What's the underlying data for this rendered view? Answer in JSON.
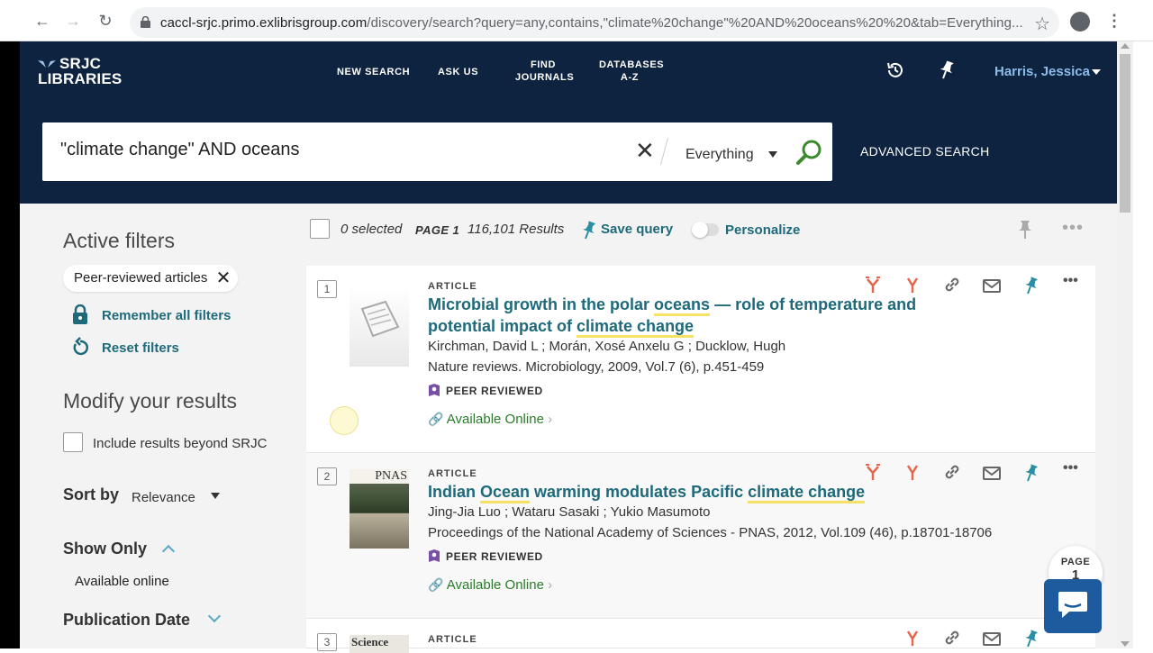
{
  "browser": {
    "url_host": "caccl-srjc.primo.exlibrisgroup.com",
    "url_path": "/discovery/search?query=any,contains,\"climate%20change\"%20AND%20oceans%20%20&tab=Everything..."
  },
  "header": {
    "logo_line1": "SRJC",
    "logo_line2": "LIBRARIES",
    "nav": [
      "NEW SEARCH",
      "ASK US",
      "FIND JOURNALS",
      "DATABASES A-Z"
    ],
    "nav_find_1": "FIND",
    "nav_find_2": "JOURNALS",
    "nav_db_1": "DATABASES",
    "nav_db_2": "A-Z",
    "user": "Harris, Jessica"
  },
  "search": {
    "query": "\"climate change\" AND oceans",
    "scope": "Everything",
    "advanced": "ADVANCED SEARCH"
  },
  "sidebar": {
    "active_filters": "Active filters",
    "chip": "Peer-reviewed articles",
    "remember": "Remember all filters",
    "reset": "Reset filters",
    "modify": "Modify your results",
    "include_beyond": "Include results beyond SRJC",
    "sort_by": "Sort by",
    "sort_value": "Relevance",
    "show_only": "Show Only",
    "available_online": "Available online",
    "publication_date": "Publication Date"
  },
  "toolbar": {
    "selected": "0 selected",
    "page": "PAGE 1",
    "results": "116,101 Results",
    "save_query": "Save query",
    "personalize": "Personalize"
  },
  "results": [
    {
      "num": "1",
      "type": "ARTICLE",
      "title_parts": [
        "Microbial growth in the polar ",
        "oceans",
        " — role of temperature and potential impact of ",
        "climate change"
      ],
      "authors": "Kirchman, David L ; Morán, Xosé Anxelu G ; Ducklow, Hugh",
      "source": "Nature reviews. Microbiology, 2009, Vol.7 (6), p.451-459",
      "peer": "PEER REVIEWED",
      "avail": "Available Online"
    },
    {
      "num": "2",
      "type": "ARTICLE",
      "title_parts": [
        "Indian ",
        "Ocean",
        " warming modulates Pacific ",
        "climate change"
      ],
      "authors": "Jing-Jia Luo ; Wataru Sasaki ; Yukio Masumoto",
      "source": "Proceedings of the National Academy of Sciences - PNAS, 2012, Vol.109 (46), p.18701-18706",
      "peer": "PEER REVIEWED",
      "avail": "Available Online",
      "thumb_label": "PNAS"
    },
    {
      "num": "3",
      "type": "ARTICLE",
      "thumb_label": "Science"
    }
  ],
  "float": {
    "page_label": "PAGE",
    "page_num": "1"
  },
  "colors": {
    "header_bg": "#0d2340",
    "teal": "#1e6a7a",
    "action_red": "#e5664b",
    "pin_teal": "#2a8fa3"
  }
}
